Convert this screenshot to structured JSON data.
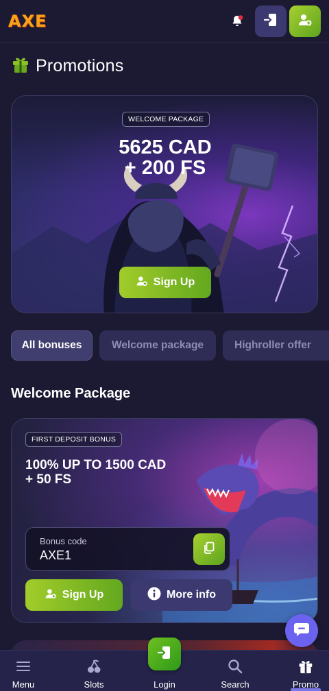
{
  "header": {
    "logo": "AXE",
    "icons": {
      "notification": "bell-icon",
      "login": "login-door-icon",
      "signup": "user-add-icon"
    },
    "colors": {
      "logo": "#f6a21a",
      "login_bg": "#3b3970",
      "signup_accent": "#8cc226"
    }
  },
  "page": {
    "title": "Promotions",
    "title_icon": "gift-icon"
  },
  "hero": {
    "badge": "WELCOME PACKAGE",
    "amount_line1": "5625 CAD",
    "amount_line2": "+ 200 FS",
    "signup_label": "Sign Up"
  },
  "filters": [
    {
      "label": "All bonuses",
      "active": true
    },
    {
      "label": "Welcome package",
      "active": false
    },
    {
      "label": "Highroller offer",
      "active": false
    }
  ],
  "welcome_section": {
    "title": "Welcome Package",
    "card": {
      "badge": "FIRST DEPOSIT BONUS",
      "title_line1": "100% UP TO 1500 CAD",
      "title_line2": "+ 50 FS",
      "bonus_code_label": "Bonus code",
      "bonus_code": "AXE1",
      "signup_label": "Sign Up",
      "more_info_label": "More info"
    }
  },
  "bottom_nav": {
    "items": [
      {
        "label": "Menu",
        "icon": "menu-icon"
      },
      {
        "label": "Slots",
        "icon": "cherries-icon"
      },
      {
        "label": "Login",
        "icon": "login-door-icon"
      },
      {
        "label": "Search",
        "icon": "search-icon"
      },
      {
        "label": "Promo",
        "icon": "gift-icon",
        "active": true
      }
    ]
  }
}
